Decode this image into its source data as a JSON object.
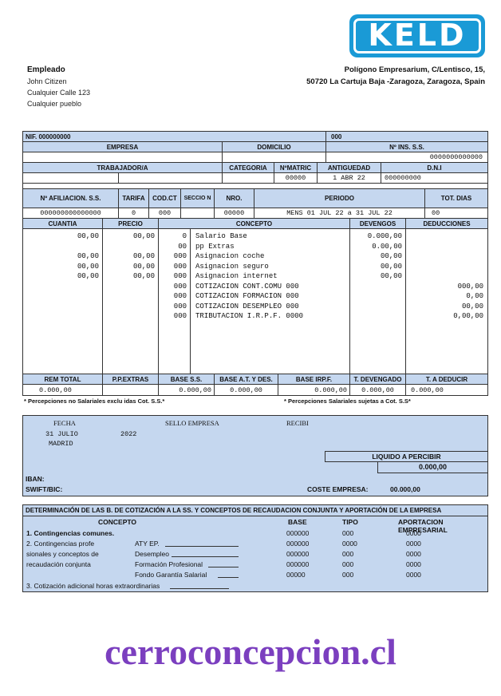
{
  "brand": {
    "logo_text": "KELD",
    "logo_color": "#1a9ad6",
    "watermark": "cerroconcepcion.cl",
    "watermark_color": "#7b3fbf"
  },
  "employee": {
    "label": "Empleado",
    "name": "John Citizen",
    "street": "Cualquier Calle 123",
    "town": "Cualquier pueblo"
  },
  "company_address": {
    "line1": "Polígono Empresarium, C/Lentisco, 15,",
    "line2": "50720 La Cartuja Baja -Zaragoza, Zaragoza, Spain"
  },
  "header": {
    "nif": "NIF. 000000000",
    "nif_value": "000",
    "empresa": "EMPRESA",
    "domicilio": "DOMICILIO",
    "ins_ss": "Nº INS. S.S.",
    "ins_ss_value": "0000000000000",
    "trabajador": "TRABAJADOR/A",
    "categoria": "CATEGORIA",
    "matric": "NºMATRIC",
    "antiguedad": "ANTIGUEDAD",
    "dni": "D.N.I",
    "matric_value": "00000",
    "antiguedad_value": "1 ABR 22",
    "dni_value": "000000000",
    "afiliacion": "Nº AFILIACION. S.S.",
    "tarifa": "TARIFA",
    "codct": "COD.CT",
    "seccion": "SECCIO N",
    "nro": "NRO.",
    "periodo": "PERIODO",
    "totdias": "TOT. DIAS",
    "afiliacion_value": "000000000000000",
    "tarifa_value": "0",
    "codct_value": "000",
    "nro_value": "00000",
    "periodo_value": "MENS 01 JUL 22 a 31 JUL 22",
    "totdias_value": "00"
  },
  "items_header": {
    "cuantia": "CUANTIA",
    "precio": "PRECIO",
    "concepto": "CONCEPTO",
    "devengos": "DEVENGOS",
    "deducciones": "DEDUCCIONES"
  },
  "items": [
    {
      "cuantia": "00,00",
      "precio": "00,00",
      "code": "0",
      "concepto": "Salario Base",
      "devengo": "0.000,00",
      "deduccion": ""
    },
    {
      "cuantia": "",
      "precio": "",
      "code": "00",
      "concepto": "pp Extras",
      "devengo": "0.00,00",
      "deduccion": ""
    },
    {
      "cuantia": "00,00",
      "precio": "00,00",
      "code": "000",
      "concepto": "Asignacion coche",
      "devengo": "00,00",
      "deduccion": ""
    },
    {
      "cuantia": "00,00",
      "precio": "00,00",
      "code": "000",
      "concepto": "Asignacion seguro",
      "devengo": "00,00",
      "deduccion": ""
    },
    {
      "cuantia": "00,00",
      "precio": "00,00",
      "code": "000",
      "concepto": "Asignacion internet",
      "devengo": "00,00",
      "deduccion": ""
    },
    {
      "cuantia": "",
      "precio": "",
      "code": "000",
      "concepto": "COTIZACION CONT.COMU 000",
      "devengo": "",
      "deduccion": "000,00"
    },
    {
      "cuantia": "",
      "precio": "",
      "code": "000",
      "concepto": "COTIZACION FORMACION 000",
      "devengo": "",
      "deduccion": "0,00"
    },
    {
      "cuantia": "",
      "precio": "",
      "code": "000",
      "concepto": "COTIZACION DESEMPLEO 000",
      "devengo": "",
      "deduccion": "00,00"
    },
    {
      "cuantia": "",
      "precio": "",
      "code": "000",
      "concepto": "TRIBUTACION I.R.P.F. 0000",
      "devengo": "",
      "deduccion": "0,00,00"
    }
  ],
  "totals_header": {
    "rem_total": "REM TOTAL",
    "pp_extras": "P.P.EXTRAS",
    "base_ss": "BASE S.S.",
    "base_aty": "BASE A.T. Y DES.",
    "base_irpf": "BASE IRP.F.",
    "t_devengado": "T. DEVENGADO",
    "t_deducir": "T. A DEDUCIR"
  },
  "totals": {
    "rem_total": "0.000,00",
    "pp_extras": "",
    "base_ss": "0.000,00",
    "base_aty": "0.000,00",
    "base_irpf": "0.000,00",
    "t_devengado": "0.000,00",
    "t_deducir": "0.000,00"
  },
  "notes": {
    "left": "* Percepciones no Salariales exclu idas Cot. S.S.*",
    "right": "* Percepciones Salariales sujetas a Cot. S.S*"
  },
  "sign": {
    "fecha": "FECHA",
    "sello": "SELLO EMPRESA",
    "recibi": "RECIBI",
    "date_day": "31 JULIO",
    "date_year": "2022",
    "city": "MADRID",
    "liquido_label": "LIQUIDO A PERCIBIR",
    "liquido_value": "0.000,00",
    "iban": "IBAN:",
    "swift": "SWIFT/BIC:",
    "coste_label": "COSTE EMPRESA:",
    "coste_value": "00.000,00"
  },
  "determinacion": {
    "title": "DETERMINACIÓN DE LAS B. DE COTIZACIÓN A LA SS. Y CONCEPTOS DE RECAUDACION CONJUNTA Y APORTACIÓN DE LA EMPRESA",
    "h_concepto": "CONCEPTO",
    "h_base": "BASE",
    "h_tipo": "TIPO",
    "h_aport": "APORTACION EMPRESARIAL",
    "c1": "1. Contingencias comunes.",
    "c2a": "2. Contingencias profe",
    "c2b": "sionales y conceptos de",
    "c2c": "recaudación conjunta",
    "aty": "ATY EP.",
    "desempleo": "Desempleo",
    "formacion": "Formación Profesional",
    "fondo": "Fondo Garantía Salarial",
    "c3": "3. Cotización adicional horas extraordinarias",
    "rows": [
      {
        "base": "000000",
        "tipo": "000",
        "aport": "0000"
      },
      {
        "base": "000000",
        "tipo": "0000",
        "aport": "0000"
      },
      {
        "base": "000000",
        "tipo": "000",
        "aport": "0000"
      },
      {
        "base": "000000",
        "tipo": "000",
        "aport": "0000"
      },
      {
        "base": "00000",
        "tipo": "000",
        "aport": "0000"
      }
    ]
  }
}
